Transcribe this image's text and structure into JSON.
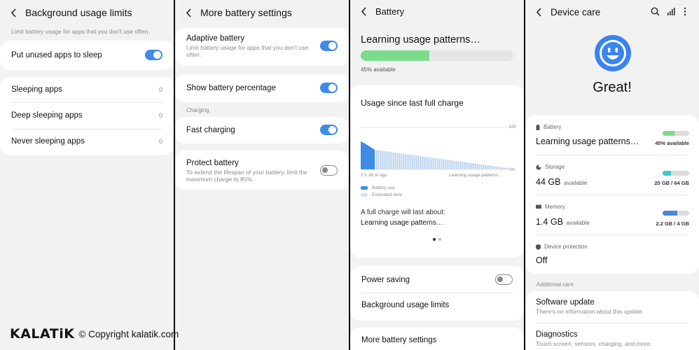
{
  "panel1": {
    "title": "Background usage limits",
    "description": "Limit battery usage for apps that you don't use often.",
    "put_unused_label": "Put unused apps to sleep",
    "put_unused_on": true,
    "lists": [
      {
        "label": "Sleeping apps",
        "count": "0"
      },
      {
        "label": "Deep sleeping apps",
        "count": "0"
      },
      {
        "label": "Never sleeping apps",
        "count": "0"
      }
    ]
  },
  "panel2": {
    "title": "More battery settings",
    "adaptive_label": "Adaptive battery",
    "adaptive_desc": "Limit battery usage for apps that you don't use often.",
    "adaptive_on": true,
    "show_pct_label": "Show battery percentage",
    "show_pct_on": true,
    "charging_section": "Charging",
    "fast_label": "Fast charging",
    "fast_on": true,
    "protect_label": "Protect battery",
    "protect_desc": "To extend the lifespan of your battery, limit the maximum charge to 85%.",
    "protect_on": false
  },
  "panel3": {
    "title": "Battery",
    "status": "Learning usage patterns…",
    "level_text": "45% available",
    "level": 0.45,
    "usage_title": "Usage since last full charge",
    "axis_top": "100",
    "axis_bottom": "0%",
    "time_start": "2 h 36 m ago",
    "time_end": "Learning usage patterns…",
    "legend_battery": "Battery use",
    "legend_estimated": "Estimated time",
    "full_charge_label": "A full charge will last about:",
    "full_charge_value": "Learning usage patterns…",
    "power_saving_label": "Power saving",
    "power_saving_on": false,
    "bg_limits_label": "Background usage limits",
    "more_settings_label": "More battery settings"
  },
  "panel4": {
    "title": "Device care",
    "headline": "Great!",
    "battery_label": "Battery",
    "battery_value": "Learning usage patterns…",
    "battery_right": "45% available",
    "battery_level": 0.45,
    "storage_label": "Storage",
    "storage_value": "44 GB",
    "storage_unit": "available",
    "storage_right": "20 GB / 64 GB",
    "storage_level": 0.31,
    "memory_label": "Memory",
    "memory_value": "1.4 GB",
    "memory_unit": "available",
    "memory_right": "2.2 GB / 4 GB",
    "memory_level": 0.55,
    "protection_label": "Device protection",
    "protection_value": "Off",
    "additional_care": "Additional care",
    "software_update_label": "Software update",
    "software_update_desc": "There's no information about this update.",
    "diagnostics_label": "Diagnostics",
    "diagnostics_desc": "Touch screen, sensors, charging, and more."
  },
  "watermark": {
    "brand": "KALATiK",
    "copyright": "© Copyright kalatik.com"
  },
  "colors": {
    "accent_blue": "#3e8be8",
    "battery_green": "#7ddc8c",
    "storage_teal": "#3ec7c9",
    "memory_blue": "#4a86d8",
    "smiley_blue": "#3a84f0"
  },
  "icons": [
    "back-icon",
    "search-icon",
    "signal-bars-icon",
    "more-vert-icon",
    "battery-icon",
    "storage-icon",
    "memory-icon",
    "shield-icon",
    "smiley-icon"
  ]
}
